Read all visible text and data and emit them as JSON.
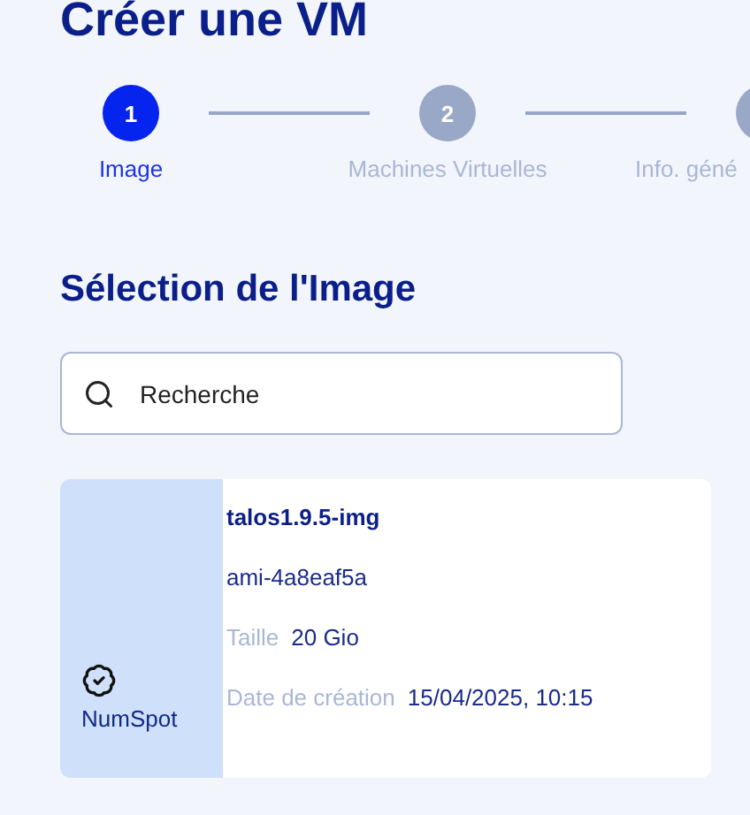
{
  "title": "Créer une VM",
  "steps": [
    {
      "number": "1",
      "label": "Image",
      "selected": true
    },
    {
      "number": "2",
      "label": "Machines Virtuelles",
      "selected": false
    },
    {
      "label": "Info. géné",
      "selected": false
    }
  ],
  "section_title": "Sélection de l'Image",
  "search": {
    "placeholder": "Recherche"
  },
  "images": [
    {
      "provider": "NumSpot",
      "name": "talos1.9.5-img",
      "id": "ami-4a8eaf5a",
      "fields": [
        {
          "label": "Taille",
          "value": "20 Gio"
        },
        {
          "label": "Date de création",
          "value": "15/04/2025, 10:15"
        }
      ]
    }
  ]
}
